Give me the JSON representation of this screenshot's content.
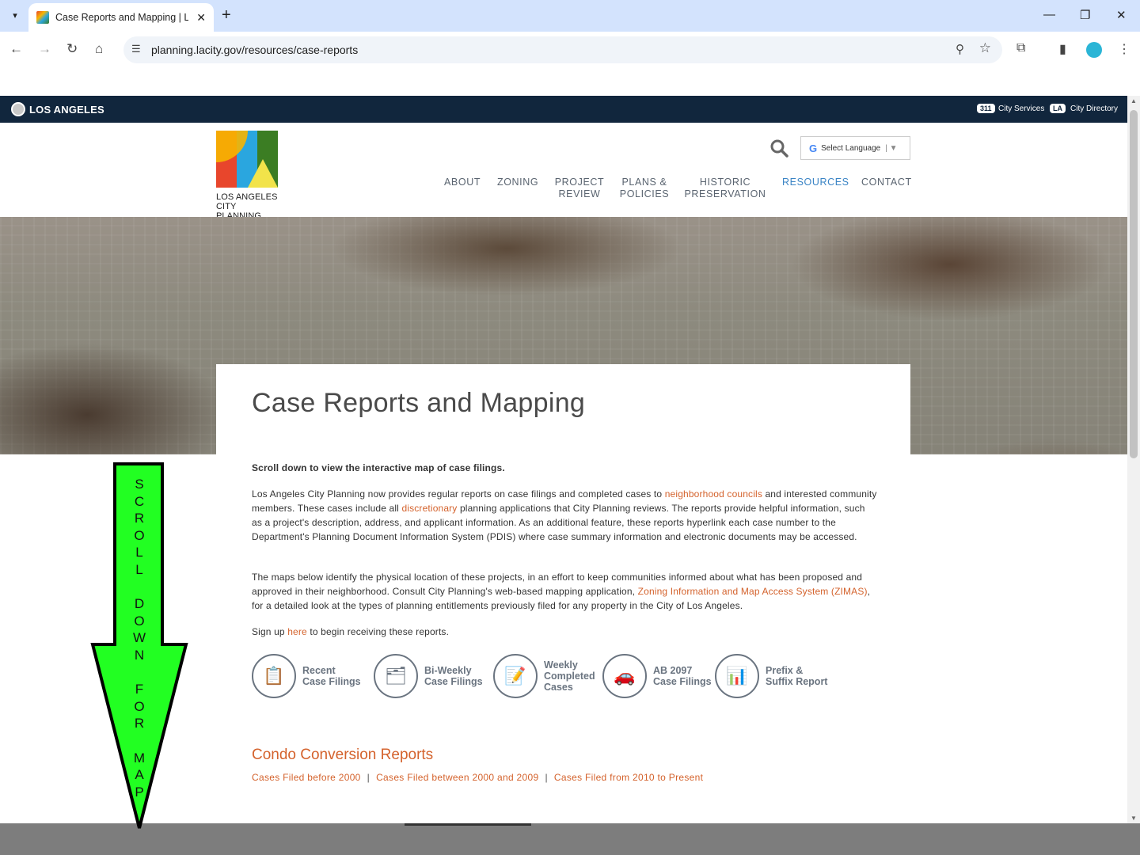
{
  "browser": {
    "tab_title": "Case Reports and Mapping | Lo",
    "url": "planning.lacity.gov/resources/case-reports"
  },
  "topbar": {
    "city": "LOS ANGELES",
    "badge_311": "311",
    "city_services": "City Services",
    "badge_la": "LA",
    "city_directory": "City Directory"
  },
  "header": {
    "logo_line1": "LOS ANGELES",
    "logo_line2": "CITY PLANNING",
    "language_select": "Select Language",
    "nav": [
      {
        "label": "ABOUT"
      },
      {
        "label": "ZONING"
      },
      {
        "label": "PROJECT REVIEW"
      },
      {
        "label": "PLANS & POLICIES"
      },
      {
        "label": "HISTORIC PRESERVATION"
      },
      {
        "label": "RESOURCES"
      },
      {
        "label": "CONTACT"
      }
    ]
  },
  "page": {
    "title": "Case Reports and Mapping",
    "intro_bold": "Scroll down to view the interactive map of case filings.",
    "p1_a": "Los Angeles City Planning now provides regular reports on case filings and completed cases to ",
    "p1_link1": "neighborhood councils",
    "p1_b": " and interested community members. These cases include all ",
    "p1_link2": "discretionary",
    "p1_c": " planning applications that City Planning reviews. The reports provide helpful information, such as a project's description, address, and applicant information. As an additional feature, these reports hyperlink each case number to the Department's Planning Document Information System (PDIS) where case summary information and electronic documents may be accessed.",
    "p2_a": "The maps below identify the physical location of these projects, in an effort to keep communities informed about what has been proposed and approved in their neighborhood. Consult City Planning's web-based mapping application, ",
    "p2_link": "Zoning Information and Map Access System (ZIMAS)",
    "p2_b": ", for a detailed look at the types of planning entitlements previously filed for any property in the City of Los Angeles.",
    "p3_a": "Sign up ",
    "p3_link": "here",
    "p3_b": " to begin receiving these reports.",
    "categories": [
      {
        "line1": "Recent",
        "line2": "Case Filings",
        "line3": ""
      },
      {
        "line1": "Bi-Weekly",
        "line2": "Case Filings",
        "line3": ""
      },
      {
        "line1": "Weekly",
        "line2": "Completed",
        "line3": "Cases"
      },
      {
        "line1": "AB 2097",
        "line2": "Case Filings",
        "line3": ""
      },
      {
        "line1": "Prefix &",
        "line2": "Suffix Report",
        "line3": ""
      }
    ],
    "condo_title": "Condo Conversion Reports",
    "condo_links": [
      "Cases Filed before 2000",
      "Cases Filed between 2000 and 2009",
      "Cases Filed from 2010 to Present"
    ],
    "condo_sep": "|"
  },
  "overlay": {
    "arrow_text": "SCROLL DOWN FOR MAP",
    "arrow_color": "#22ff22"
  }
}
